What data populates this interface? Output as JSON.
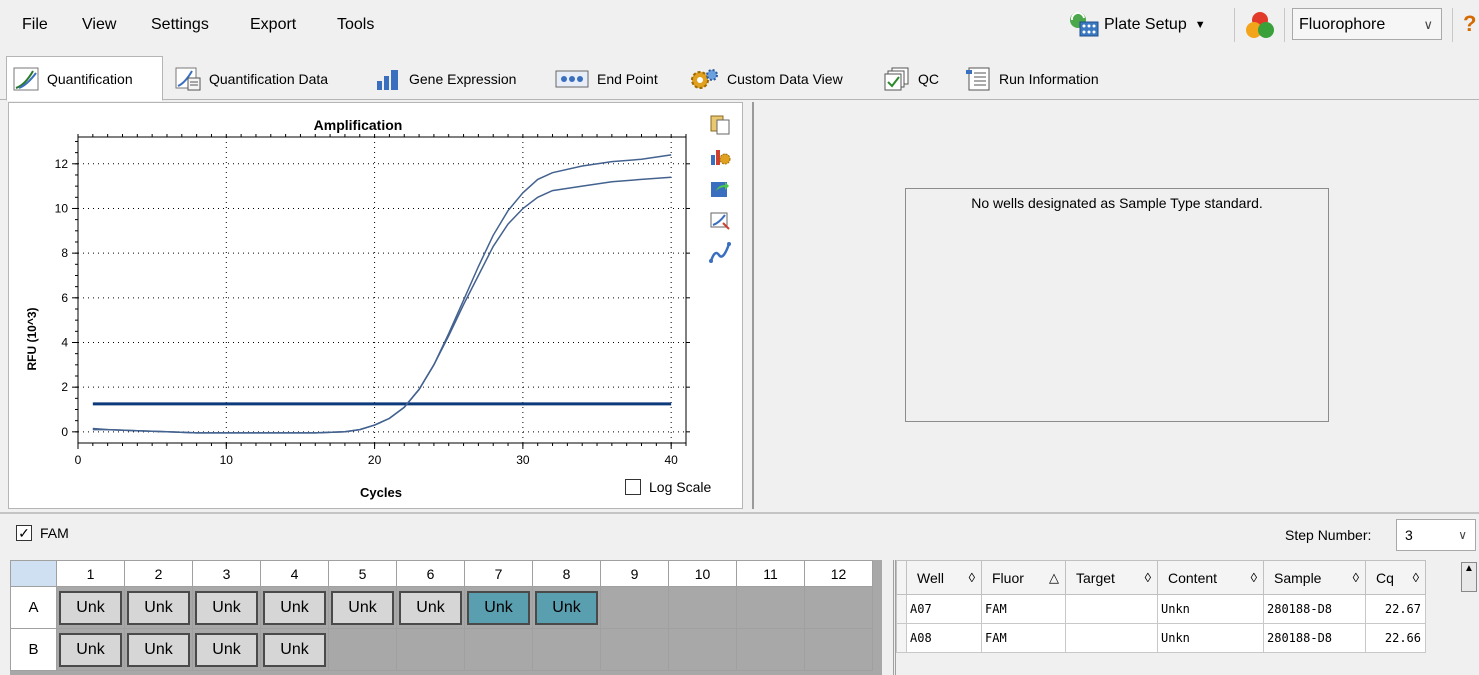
{
  "menu": [
    "File",
    "View",
    "Settings",
    "Export",
    "Tools"
  ],
  "toolbar": {
    "plate_setup": "Plate Setup",
    "fluor_select": "Fluorophore"
  },
  "tabs": [
    "Quantification",
    "Quantification Data",
    "Gene Expression",
    "End Point",
    "Custom Data View",
    "QC",
    "Run Information"
  ],
  "chart": {
    "log_scale_label": "Log Scale"
  },
  "standard_message": "No wells designated as Sample Type standard.",
  "fam": {
    "label": "FAM",
    "checked": true
  },
  "step": {
    "label": "Step Number:",
    "value": "3"
  },
  "plate": {
    "columns": [
      "1",
      "2",
      "3",
      "4",
      "5",
      "6",
      "7",
      "8",
      "9",
      "10",
      "11",
      "12"
    ],
    "rows": [
      {
        "label": "A",
        "wells": [
          "Unk",
          "Unk",
          "Unk",
          "Unk",
          "Unk",
          "Unk",
          "Unk",
          "Unk",
          "",
          "",
          "",
          ""
        ],
        "selected": [
          6,
          7
        ]
      },
      {
        "label": "B",
        "wells": [
          "Unk",
          "Unk",
          "Unk",
          "Unk",
          "",
          "",
          "",
          "",
          "",
          "",
          "",
          ""
        ],
        "selected": []
      }
    ]
  },
  "table": {
    "headers": [
      "Well",
      "Fluor",
      "Target",
      "Content",
      "Sample",
      "Cq"
    ],
    "sort_glyphs": [
      "◊",
      "△",
      "◊",
      "◊",
      "◊",
      "◊"
    ],
    "rows": [
      {
        "well": "A07",
        "fluor": "FAM",
        "target": "",
        "content": "Unkn",
        "sample": "280188-D8",
        "cq": "22.67"
      },
      {
        "well": "A08",
        "fluor": "FAM",
        "target": "",
        "content": "Unkn",
        "sample": "280188-D8",
        "cq": "22.66"
      }
    ]
  },
  "chart_data": {
    "type": "line",
    "title": "Amplification",
    "xlabel": "Cycles",
    "ylabel": "RFU (10^3)",
    "xlim": [
      0,
      41
    ],
    "ylim": [
      -0.5,
      13.2
    ],
    "xticks": [
      0,
      10,
      20,
      30,
      40
    ],
    "yticks": [
      0,
      2,
      4,
      6,
      8,
      10,
      12
    ],
    "grid": true,
    "log_scale": false,
    "threshold": 1.25,
    "series": [
      {
        "x": [
          1,
          2,
          4,
          6,
          8,
          10,
          12,
          14,
          16,
          18,
          19,
          20,
          21,
          22,
          23,
          24,
          25,
          26,
          27,
          28,
          29,
          30,
          31,
          32,
          34,
          36,
          38,
          40
        ],
        "values": [
          0.15,
          0.1,
          0.05,
          0.0,
          -0.05,
          -0.05,
          -0.05,
          -0.05,
          -0.05,
          0.0,
          0.1,
          0.3,
          0.6,
          1.1,
          1.9,
          3.0,
          4.4,
          5.9,
          7.4,
          8.8,
          9.9,
          10.7,
          11.3,
          11.6,
          11.9,
          12.1,
          12.2,
          12.4
        ]
      },
      {
        "x": [
          1,
          2,
          4,
          6,
          8,
          10,
          12,
          14,
          16,
          18,
          19,
          20,
          21,
          22,
          23,
          24,
          25,
          26,
          27,
          28,
          29,
          30,
          31,
          32,
          34,
          36,
          38,
          40
        ],
        "values": [
          0.1,
          0.1,
          0.05,
          0.0,
          -0.05,
          -0.05,
          -0.05,
          -0.05,
          -0.05,
          0.0,
          0.1,
          0.3,
          0.6,
          1.1,
          1.9,
          3.0,
          4.3,
          5.7,
          7.0,
          8.3,
          9.3,
          10.0,
          10.5,
          10.8,
          11.0,
          11.2,
          11.3,
          11.4
        ]
      }
    ]
  }
}
